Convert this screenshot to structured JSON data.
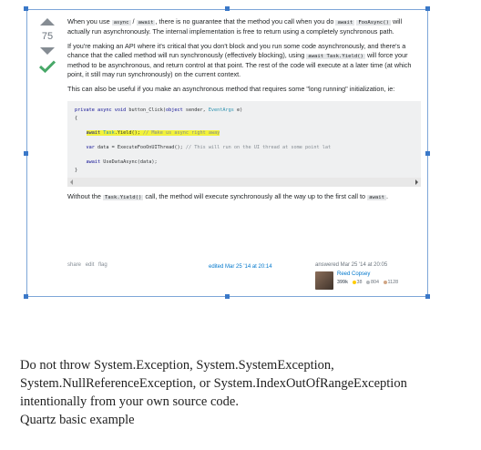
{
  "vote": {
    "count": "75"
  },
  "post": {
    "p1": {
      "t1": "When you use ",
      "c1": "async",
      "t2": " / ",
      "c2": "await",
      "t3": ", there is no guarantee that the method you call when you do ",
      "c3": "await",
      "t4": " ",
      "c4": "FooAsync()",
      "t5": " will actually run asynchronously. The internal implementation is free to return using a completely synchronous path."
    },
    "p2": {
      "t1": "If you're making an API where it's critical that you don't block and you run some code asynchronously, and there's a chance that the called method will run synchronously (effectively blocking), using ",
      "c1": "await Task.Yield()",
      "t2": " will force your method to be asynchronous, and return control at that point. The rest of the code will execute at a later time (at which point, it still may run synchronously) on the current context."
    },
    "p3": "This can also be useful if you make an asynchronous method that requires some \"long running\" initialization, ie:",
    "code": {
      "l1_kw": "private async void",
      "l1_rest": " button_Click(",
      "l1_kw2": "object",
      "l1_rest2": " sender, ",
      "l1_id": "EventArgs",
      "l1_rest3": " e)",
      "l2": "{",
      "l3_kw": "await",
      "l3_id": " Task",
      "l3_rest": ".Yield(); ",
      "l3_cm": "// Make us async right away",
      "l4_kw": "var",
      "l4_rest": " data = ExecuteFooOnUIThread(); ",
      "l4_cm": "// This will run on the UI thread at some point lat",
      "l5_kw": "await",
      "l5_rest": " UseDataAsync(data);",
      "l6": "}"
    },
    "p4": {
      "t1": "Without the ",
      "c1": "Task.Yield()",
      "t2": " call, the method will execute synchronously all the way up to the first call to ",
      "c2": "await",
      "t3": "."
    }
  },
  "meta": {
    "share": "share",
    "edit": "edit",
    "flag": "flag",
    "edited": "edited Mar 25 '14 at 20:14",
    "answered": "answered Mar 25 '14 at 20:05",
    "user_name": "Reed Copsey",
    "reputation": "399k",
    "gold": "38",
    "silver": "804",
    "bronze": "1128"
  },
  "below": {
    "line1": "Do not throw System.Exception, System.SystemException,",
    "line2": "System.NullReferenceException, or System.IndexOutOfRangeException",
    "line3": "intentionally from your own source code.",
    "line4": "Quartz basic example"
  },
  "colors": {
    "accept": "#48a868",
    "link": "#0077cc",
    "highlight": "#f2f23a",
    "gold": "#ffcc01",
    "silver": "#b4b8bc",
    "bronze": "#d1a684"
  },
  "icons": [
    "arrow-up-icon",
    "arrow-down-icon",
    "accepted-check-icon",
    "avatar"
  ]
}
